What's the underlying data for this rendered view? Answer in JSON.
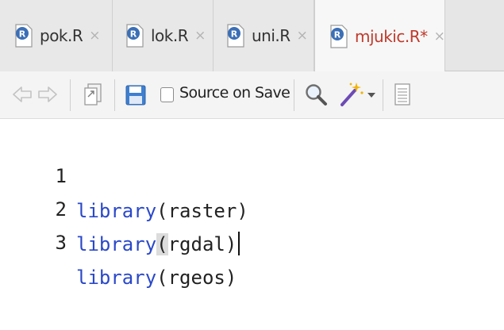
{
  "tabs": [
    {
      "label": "pok.R",
      "close": "×"
    },
    {
      "label": "lok.R",
      "close": "×"
    },
    {
      "label": "uni.R",
      "close": "×"
    },
    {
      "label": "mjukic.R*",
      "close": "×",
      "active": true
    }
  ],
  "toolbar": {
    "source_on_save_label": "Source on Save",
    "source_on_save_checked": false
  },
  "editor": {
    "lines": [
      {
        "number": "1",
        "func": "library",
        "open": "(",
        "arg": "raster",
        "close": ")"
      },
      {
        "number": "2",
        "func": "library",
        "open": "(",
        "arg": "rgdal",
        "close": ")"
      },
      {
        "number": "3",
        "func": "library",
        "open": "(",
        "arg": "rgeos",
        "close": ")"
      }
    ]
  },
  "colors": {
    "keyword": "#2a48c9",
    "active_tab_text": "#c0392b",
    "r_icon_blue": "#3b6fb6"
  }
}
